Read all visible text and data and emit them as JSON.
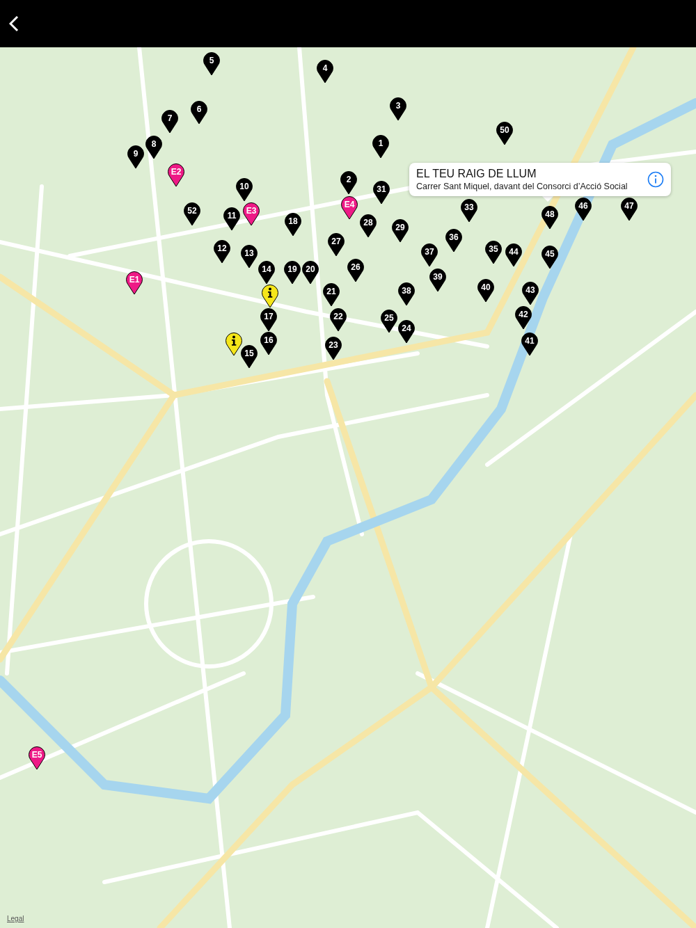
{
  "callout": {
    "title": "EL TEU RAIG DE LLUM",
    "subtitle": "Carrer Sant Miquel, davant del Consorci d’Acció Social"
  },
  "pins": [
    {
      "kind": "number",
      "label": "5"
    },
    {
      "kind": "number",
      "label": "4"
    },
    {
      "kind": "number",
      "label": "3"
    },
    {
      "kind": "number",
      "label": "50"
    },
    {
      "kind": "number",
      "label": "6"
    },
    {
      "kind": "number",
      "label": "7"
    },
    {
      "kind": "number",
      "label": "1"
    },
    {
      "kind": "number",
      "label": "8"
    },
    {
      "kind": "number",
      "label": "9"
    },
    {
      "kind": "event",
      "label": "E2"
    },
    {
      "kind": "number",
      "label": "10"
    },
    {
      "kind": "number",
      "label": "2"
    },
    {
      "kind": "number",
      "label": "31"
    },
    {
      "kind": "event",
      "label": "E3"
    },
    {
      "kind": "event",
      "label": "E4"
    },
    {
      "kind": "number",
      "label": "52"
    },
    {
      "kind": "number",
      "label": "33"
    },
    {
      "kind": "number",
      "label": "48"
    },
    {
      "kind": "number",
      "label": "46"
    },
    {
      "kind": "number",
      "label": "47"
    },
    {
      "kind": "number",
      "label": "11"
    },
    {
      "kind": "number",
      "label": "18"
    },
    {
      "kind": "number",
      "label": "28"
    },
    {
      "kind": "number",
      "label": "29"
    },
    {
      "kind": "number",
      "label": "36"
    },
    {
      "kind": "number",
      "label": "27"
    },
    {
      "kind": "number",
      "label": "12"
    },
    {
      "kind": "number",
      "label": "13"
    },
    {
      "kind": "number",
      "label": "37"
    },
    {
      "kind": "number",
      "label": "35"
    },
    {
      "kind": "number",
      "label": "44"
    },
    {
      "kind": "number",
      "label": "45"
    },
    {
      "kind": "event",
      "label": "E1"
    },
    {
      "kind": "number",
      "label": "14"
    },
    {
      "kind": "info"
    },
    {
      "kind": "number",
      "label": "19"
    },
    {
      "kind": "number",
      "label": "20"
    },
    {
      "kind": "number",
      "label": "21"
    },
    {
      "kind": "number",
      "label": "26"
    },
    {
      "kind": "number",
      "label": "38"
    },
    {
      "kind": "number",
      "label": "39"
    },
    {
      "kind": "number",
      "label": "40"
    },
    {
      "kind": "number",
      "label": "43"
    },
    {
      "kind": "number",
      "label": "17"
    },
    {
      "kind": "number",
      "label": "22"
    },
    {
      "kind": "number",
      "label": "25"
    },
    {
      "kind": "number",
      "label": "24"
    },
    {
      "kind": "number",
      "label": "42"
    },
    {
      "kind": "info"
    },
    {
      "kind": "number",
      "label": "15"
    },
    {
      "kind": "number",
      "label": "16"
    },
    {
      "kind": "number",
      "label": "23"
    },
    {
      "kind": "number",
      "label": "41"
    },
    {
      "kind": "event",
      "label": "E5"
    }
  ],
  "legal_link": "Legal"
}
